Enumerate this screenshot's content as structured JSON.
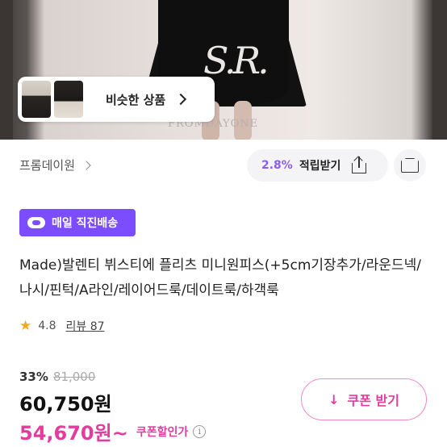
{
  "hero": {
    "logo": "S.R.",
    "watermark": "FROMDAYONE"
  },
  "similar": {
    "label": "비슷한 상품"
  },
  "store": {
    "name": "프롬데이원"
  },
  "reward": {
    "rate": "2.8%",
    "label": "적립받기"
  },
  "badge": {
    "label": "매일 직진배송"
  },
  "product": {
    "title": "Made)발렌티 뷔스티에 플리츠 미니원피스(+5cm기장추가/라운드넥/나시/핀턱/A라인/레이어드룩/데이트룩/하객룩"
  },
  "rating": {
    "score": "4.8",
    "reviews": "리뷰 87"
  },
  "price": {
    "discount_rate": "33%",
    "original": "81,000",
    "sale": "60,750원",
    "coupon_price": "54,670원~",
    "coupon_label": "쿠폰할인가",
    "info_glyph": "i"
  },
  "coupon_button": {
    "icon": "↓",
    "label": "쿠폰 받기"
  },
  "icons": {
    "similar_chevron": "chevron-right-icon",
    "store_chevron": "chevron-right-icon",
    "share": "share-icon",
    "size": "shirt-icon",
    "star": "star-icon",
    "download": "download-icon"
  },
  "colors": {
    "accent_purple": "#7c4dff",
    "reward_purple": "#8b5cf6",
    "coupon_pink": "#e23d9e",
    "star": "#f5a623"
  }
}
